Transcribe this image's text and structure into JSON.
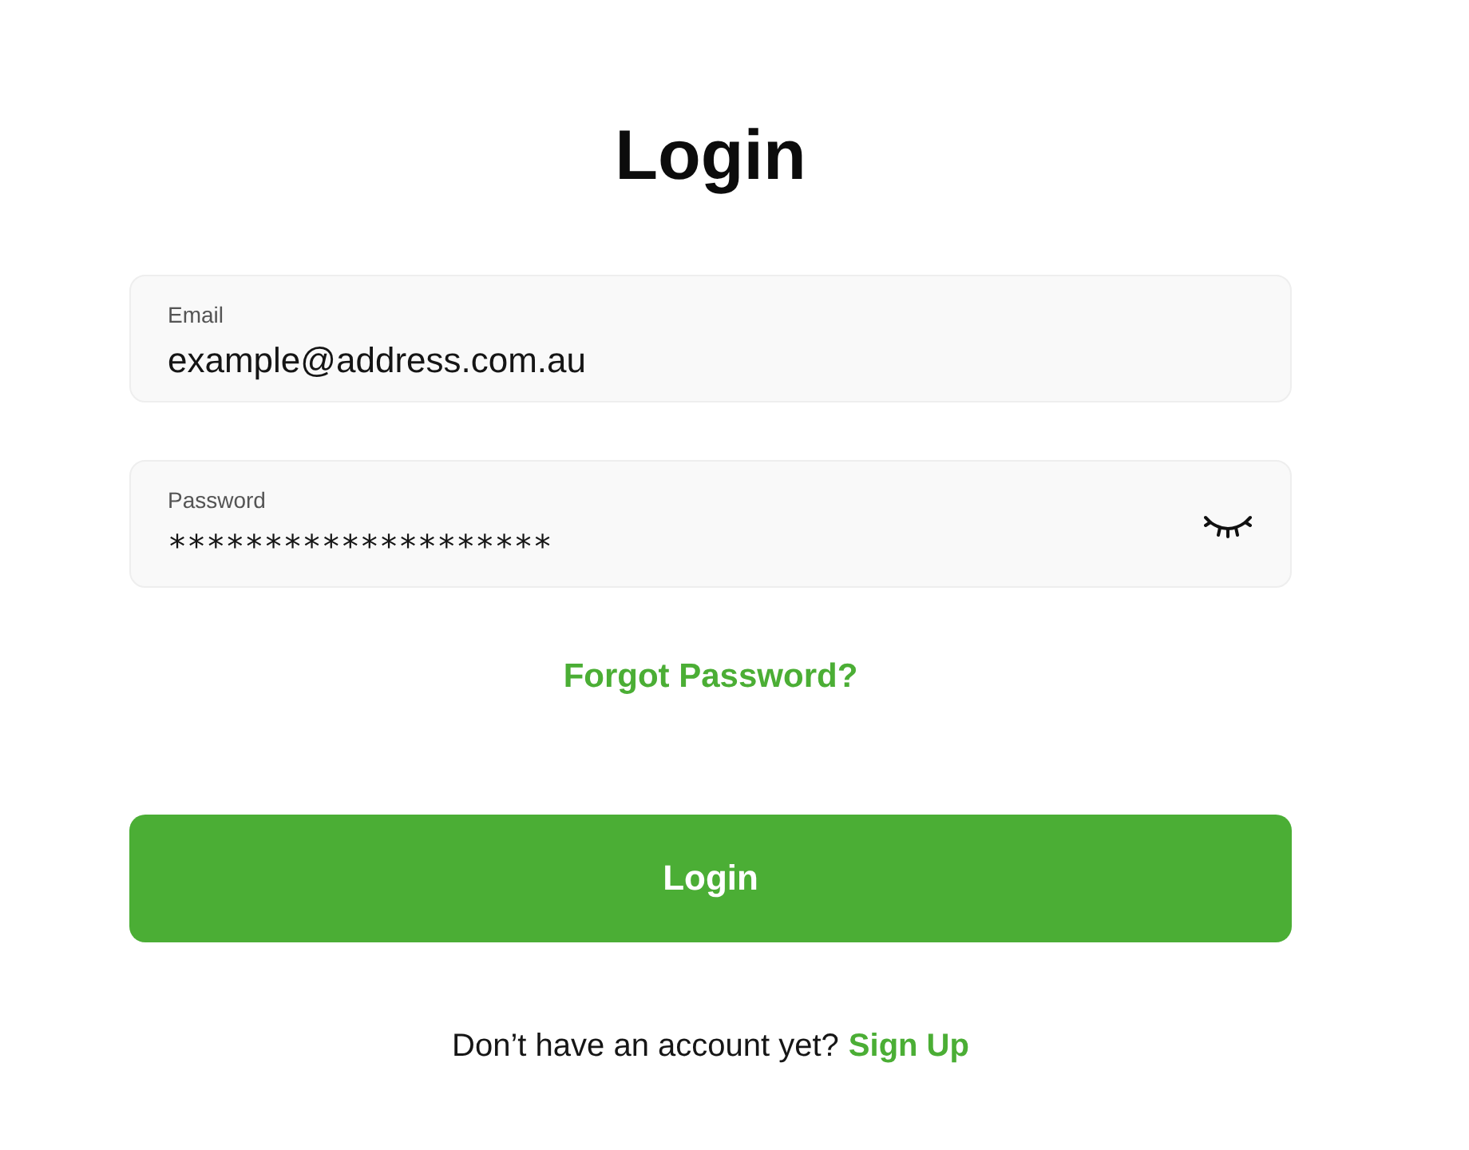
{
  "title": "Login",
  "fields": [
    {
      "kind": "text",
      "label": "Email",
      "value": "example@address.com.au"
    },
    {
      "kind": "password",
      "label": "Password",
      "value": "********************"
    }
  ],
  "forgot_link": "Forgot Password?",
  "submit_button": "Login",
  "signup": {
    "text": "Don’t have an account yet?",
    "link": "Sign Up"
  }
}
